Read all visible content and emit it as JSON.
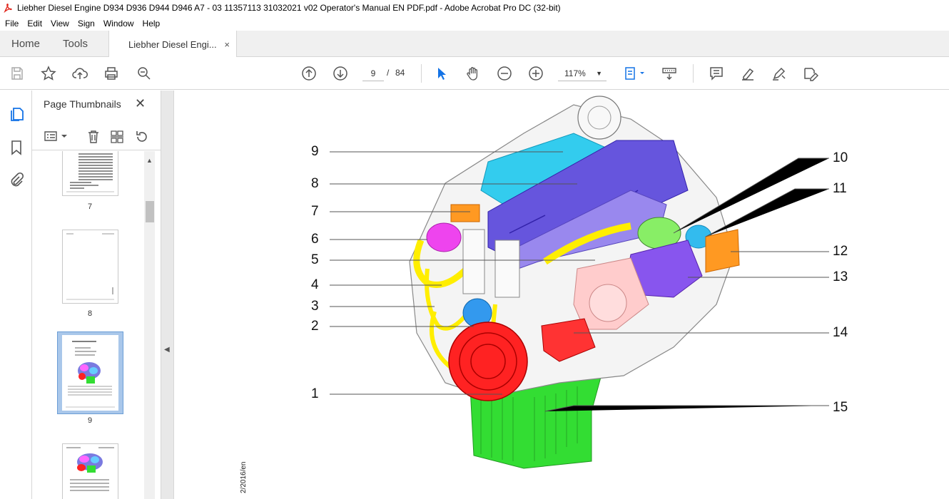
{
  "window": {
    "title": "Liebher Diesel Engine D934 D936 D944 D946 A7 - 03 11357113 31032021 v02 Operator's Manual EN PDF.pdf - Adobe Acrobat Pro DC (32-bit)"
  },
  "menu": [
    "File",
    "Edit",
    "View",
    "Sign",
    "Window",
    "Help"
  ],
  "tabs": {
    "home": "Home",
    "tools": "Tools",
    "document": "Liebher Diesel Engi...",
    "close": "×"
  },
  "toolbar": {
    "current_page": "9",
    "separator": "/",
    "total_pages": "84",
    "zoom": "117%"
  },
  "panel": {
    "title": "Page Thumbnails",
    "close": "✕",
    "thumbnails": [
      {
        "page": "7"
      },
      {
        "page": "8"
      },
      {
        "page": "9",
        "selected": true
      }
    ]
  },
  "document": {
    "callouts_left": [
      "9",
      "8",
      "7",
      "6",
      "5",
      "4",
      "3",
      "2",
      "1"
    ],
    "callouts_right": [
      "10",
      "11",
      "12",
      "13",
      "14",
      "15"
    ],
    "footer_text": "2/2016/en"
  },
  "colors": {
    "accent": "#1473e6",
    "selected_thumb": "#a9c7ea"
  }
}
